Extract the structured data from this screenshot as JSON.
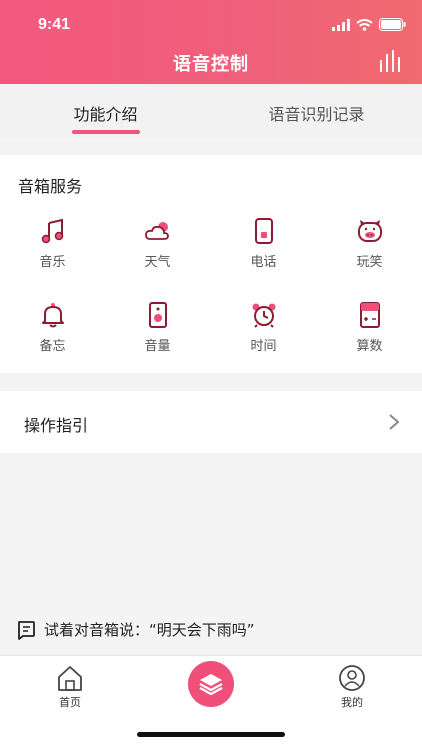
{
  "status_bar": {
    "time": "9:41"
  },
  "header": {
    "title": "语音控制",
    "right_icon": "equalizer-icon"
  },
  "tabs": [
    {
      "label": "功能介绍",
      "active": true
    },
    {
      "label": "语音识别记录",
      "active": false
    }
  ],
  "speaker_service": {
    "title": "音箱服务",
    "items": [
      {
        "label": "音乐",
        "icon": "music-icon"
      },
      {
        "label": "天气",
        "icon": "weather-icon"
      },
      {
        "label": "电话",
        "icon": "phone-icon"
      },
      {
        "label": "玩笑",
        "icon": "pig-icon"
      },
      {
        "label": "备忘",
        "icon": "bell-icon"
      },
      {
        "label": "音量",
        "icon": "speaker-icon"
      },
      {
        "label": "时间",
        "icon": "alarm-clock-icon"
      },
      {
        "label": "算数",
        "icon": "calculator-icon"
      }
    ]
  },
  "guide": {
    "label": "操作指引"
  },
  "hint": {
    "text": "试着对音箱说：“明天会下雨吗”"
  },
  "bottom_nav": {
    "home_label": "首页",
    "me_label": "我的"
  },
  "colors": {
    "accent": "#f1567a",
    "icon_dark": "#8b1d33"
  }
}
